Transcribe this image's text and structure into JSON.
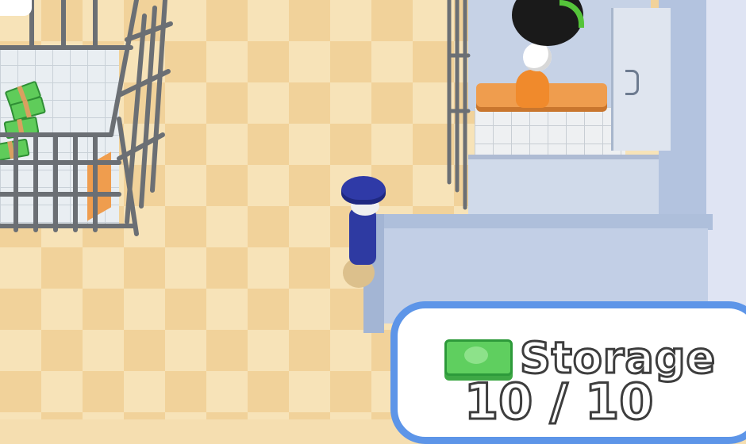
{
  "hud": {
    "storage": {
      "label": "Storage",
      "current": "10",
      "separator": "/",
      "capacity": "10",
      "icon": "cash-stack-icon",
      "accent_color": "#5d95e8"
    },
    "timer": {
      "icon": "progress-ring-icon",
      "progress_color": "#55c43a"
    }
  },
  "scene": {
    "player": "guard",
    "prisoner_outfit_color": "#f08a2c",
    "money_color": "#5fcc5a"
  }
}
